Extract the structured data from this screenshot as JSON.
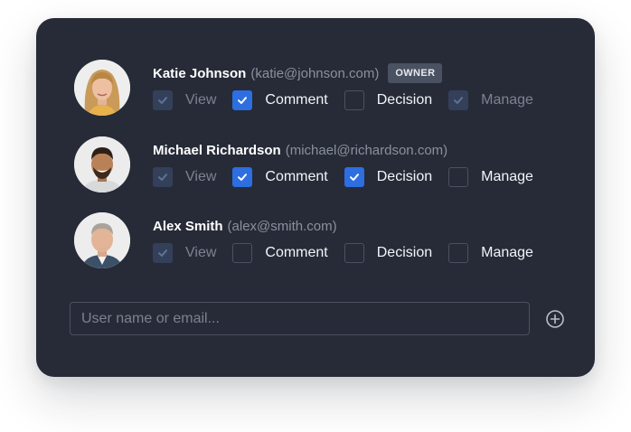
{
  "users": [
    {
      "name": "Katie Johnson",
      "email": "(katie@johnson.com)",
      "badge": "OWNER",
      "permissions": [
        {
          "label": "View",
          "state": "locked"
        },
        {
          "label": "Comment",
          "state": "checked"
        },
        {
          "label": "Decision",
          "state": "unchecked"
        },
        {
          "label": "Manage",
          "state": "locked"
        }
      ]
    },
    {
      "name": "Michael Richardson",
      "email": "(michael@richardson.com)",
      "permissions": [
        {
          "label": "View",
          "state": "locked"
        },
        {
          "label": "Comment",
          "state": "checked"
        },
        {
          "label": "Decision",
          "state": "checked"
        },
        {
          "label": "Manage",
          "state": "unchecked"
        }
      ]
    },
    {
      "name": "Alex Smith",
      "email": "(alex@smith.com)",
      "permissions": [
        {
          "label": "View",
          "state": "locked"
        },
        {
          "label": "Comment",
          "state": "unchecked"
        },
        {
          "label": "Decision",
          "state": "unchecked"
        },
        {
          "label": "Manage",
          "state": "unchecked"
        }
      ]
    }
  ],
  "add_user": {
    "placeholder": "User name or email...",
    "button_icon": "plus-circle-icon"
  },
  "colors": {
    "card": "#262b37",
    "accent": "#2d6ee0",
    "locked": "#34405a",
    "badge": "#4a5161"
  }
}
